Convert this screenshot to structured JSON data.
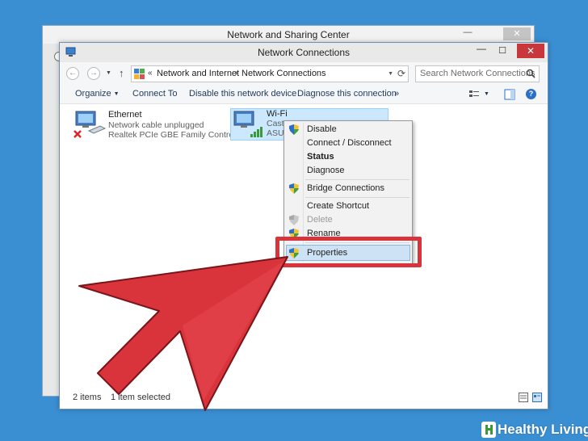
{
  "background_window": {
    "title": "Network and Sharing Center",
    "close_label": "✕",
    "minimize_label": "—"
  },
  "window": {
    "title": "Network Connections",
    "close_label": "✕",
    "minimize_label": "—",
    "maximize_label": "☐"
  },
  "address": {
    "prefix": "«",
    "crumb1": "Network and Internet",
    "separator": "›",
    "crumb2": "Network Connections",
    "search_placeholder": "Search Network Connections"
  },
  "toolbar": {
    "organize": "Organize",
    "connect_to": "Connect To",
    "disable_device": "Disable this network device",
    "diagnose": "Diagnose this connection",
    "more": "»"
  },
  "items": [
    {
      "name": "Ethernet",
      "line1": "Network cable unplugged",
      "line2": "Realtek PCIe GBE Family Controller"
    },
    {
      "name": "Wi-Fi",
      "line1": "Castr",
      "line2": "ASUS"
    }
  ],
  "context_menu": {
    "items": [
      {
        "label": "Disable",
        "shield": true,
        "bold": false,
        "disabled": false
      },
      {
        "label": "Connect / Disconnect",
        "shield": false,
        "bold": false,
        "disabled": false
      },
      {
        "label": "Status",
        "shield": false,
        "bold": true,
        "disabled": false
      },
      {
        "label": "Diagnose",
        "shield": false,
        "bold": false,
        "disabled": false
      },
      {
        "label": "Bridge Connections",
        "shield": true,
        "bold": false,
        "disabled": false
      },
      {
        "label": "Create Shortcut",
        "shield": false,
        "bold": false,
        "disabled": false
      },
      {
        "label": "Delete",
        "shield": true,
        "bold": false,
        "disabled": true
      },
      {
        "label": "Rename",
        "shield": true,
        "bold": false,
        "disabled": false
      },
      {
        "label": "Properties",
        "shield": true,
        "bold": false,
        "disabled": false,
        "highlighted": true
      }
    ]
  },
  "status_bar": {
    "count": "2 items",
    "selected": "1 item selected"
  },
  "watermark": {
    "text": "Healthy Living"
  },
  "colors": {
    "desktop": "#3a8fd3",
    "arrow": "#d9343c",
    "selection": "#cce8ff",
    "close_button": "#c7373b"
  }
}
